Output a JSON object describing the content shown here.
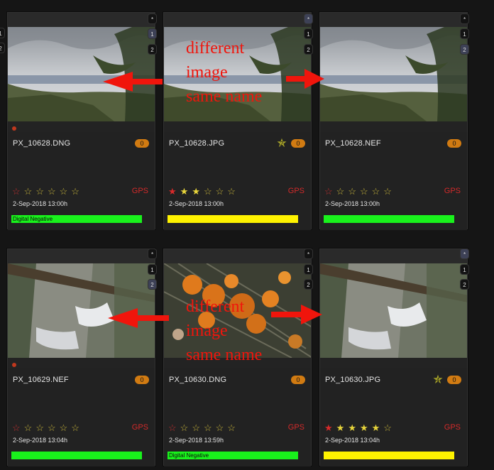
{
  "cards": [
    {
      "filename": "PX_10628.DNG",
      "count": "0",
      "stars": [
        "empty-red",
        "empty",
        "empty",
        "empty",
        "empty",
        "empty"
      ],
      "gps": "GPS",
      "date": "2-Sep-2018 13:00h",
      "bar_label": "Digital Negative",
      "bar_color": "green",
      "badge_rating": "",
      "dot": true,
      "photo": "landscape"
    },
    {
      "filename": "PX_10628.JPG",
      "count": "0",
      "stars": [
        "red",
        "yellow",
        "yellow",
        "empty",
        "empty",
        "empty"
      ],
      "gps": "GPS",
      "date": "2-Sep-2018 13:00h",
      "bar_label": "",
      "bar_color": "yellow",
      "badge_rating": "2",
      "dot": false,
      "photo": "landscape"
    },
    {
      "filename": "PX_10628.NEF",
      "count": "0",
      "stars": [
        "empty-red",
        "empty",
        "empty",
        "empty",
        "empty",
        "empty"
      ],
      "gps": "GPS",
      "date": "2-Sep-2018 13:00h",
      "bar_label": "",
      "bar_color": "green",
      "badge_rating": "",
      "dot": false,
      "photo": "landscape"
    },
    {
      "filename": "PX_10629.NEF",
      "count": "0",
      "stars": [
        "empty-red",
        "empty",
        "empty",
        "empty",
        "empty",
        "empty"
      ],
      "gps": "GPS",
      "date": "2-Sep-2018 13:04h",
      "bar_label": "",
      "bar_color": "green",
      "badge_rating": "",
      "dot": true,
      "photo": "river"
    },
    {
      "filename": "PX_10630.DNG",
      "count": "0",
      "stars": [
        "empty-red",
        "empty",
        "empty",
        "empty",
        "empty",
        "empty"
      ],
      "gps": "GPS",
      "date": "2-Sep-2018 13:59h",
      "bar_label": "Digital Negative",
      "bar_color": "green",
      "badge_rating": "",
      "dot": false,
      "photo": "mushroom"
    },
    {
      "filename": "PX_10630.JPG",
      "count": "0",
      "stars": [
        "red",
        "yellow",
        "yellow",
        "yellow",
        "yellow",
        "empty"
      ],
      "gps": "GPS",
      "date": "2-Sep-2018 13:04h",
      "bar_label": "",
      "bar_color": "yellow",
      "badge_rating": "4",
      "dot": false,
      "photo": "river"
    }
  ],
  "side_tabs": {
    "star": "*",
    "one": "1",
    "two": "2"
  },
  "annotations": {
    "top": "different\nimage\nsame name",
    "bottom": "different\nimage\nsame name"
  },
  "colors": {
    "arrow": "#f0150c",
    "green_bar": "#19f21c",
    "yellow_bar": "#fff300",
    "count_badge": "#d17b12"
  },
  "icons": {
    "star_empty": "☆",
    "star_filled": "★"
  }
}
